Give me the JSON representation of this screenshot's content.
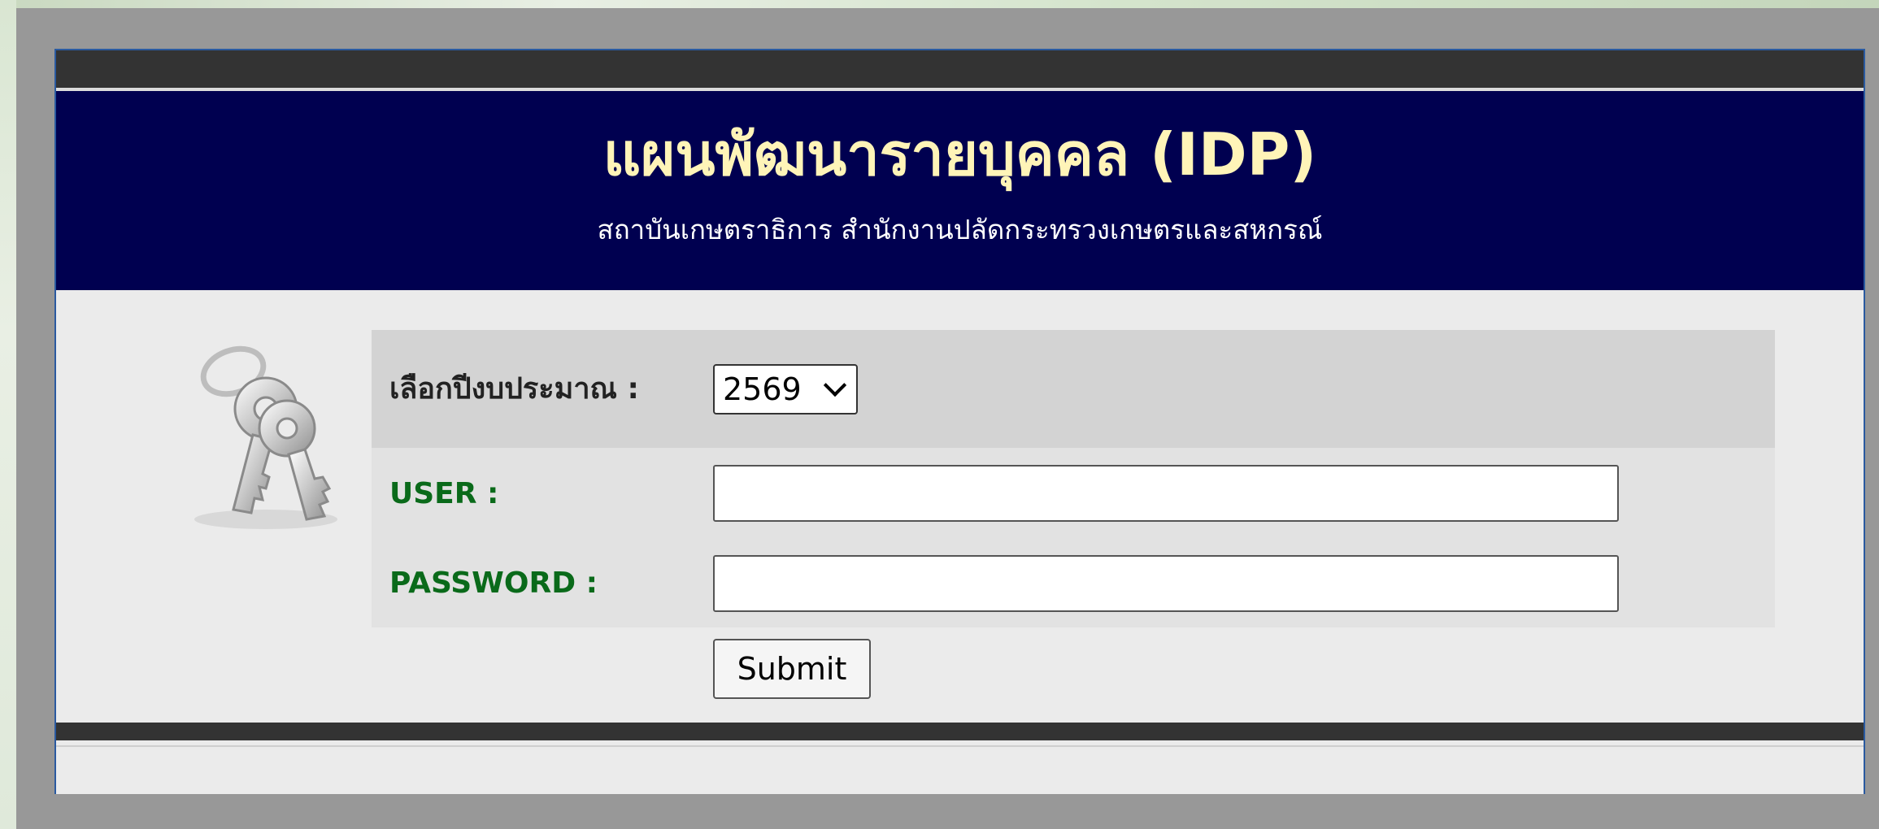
{
  "header": {
    "title": "แผนพัฒนารายบุคคล (IDP)",
    "subtitle": "สถาบันเกษตราธิการ สำนักงานปลัดกระทรวงเกษตรและสหกรณ์"
  },
  "form": {
    "year_label": "เลือกปีงบประมาณ :",
    "year_value": "2569",
    "user_label": "USER :",
    "user_value": "",
    "password_label": "PASSWORD :",
    "password_value": "",
    "submit_label": "Submit"
  },
  "colors": {
    "header_bg": "#000050",
    "title_color": "#fff4b8",
    "label_green": "#0a6a1a",
    "bar_dark": "#333333"
  },
  "icons": {
    "keys": "keys-icon"
  }
}
